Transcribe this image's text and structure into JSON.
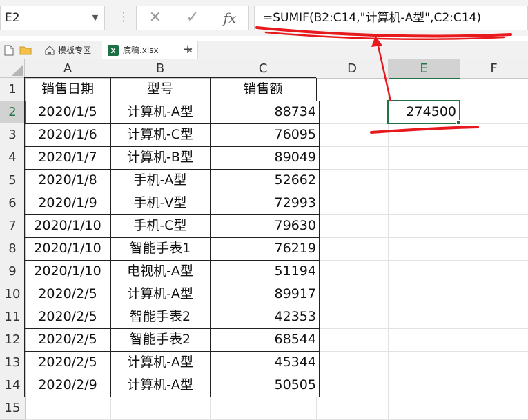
{
  "formula_bar": {
    "name_box": "E2",
    "cancel_icon": "✕",
    "enter_icon": "✓",
    "fx_label": "fx",
    "formula": "=SUMIF(B2:C14,\"计算机-A型\",C2:C14)"
  },
  "tabs": {
    "template_label": "模板专区",
    "file_label": "底稿.xlsx",
    "add_label": "+"
  },
  "sheet": {
    "columns": [
      "A",
      "B",
      "C",
      "D",
      "E",
      "F"
    ],
    "rows": [
      "1",
      "2",
      "3",
      "4",
      "5",
      "6",
      "7",
      "8",
      "9",
      "10",
      "11",
      "12",
      "13",
      "14",
      "15"
    ],
    "headers": {
      "date": "销售日期",
      "model": "型号",
      "amount": "销售额"
    },
    "records": [
      {
        "date": "2020/1/5",
        "model": "计算机-A型",
        "amount": "88734"
      },
      {
        "date": "2020/1/6",
        "model": "计算机-C型",
        "amount": "76095"
      },
      {
        "date": "2020/1/7",
        "model": "计算机-B型",
        "amount": "89049"
      },
      {
        "date": "2020/1/8",
        "model": "手机-A型",
        "amount": "52662"
      },
      {
        "date": "2020/1/9",
        "model": "手机-V型",
        "amount": "72993"
      },
      {
        "date": "2020/1/10",
        "model": "手机-C型",
        "amount": "79630"
      },
      {
        "date": "2020/1/10",
        "model": "智能手表1",
        "amount": "76219"
      },
      {
        "date": "2020/1/10",
        "model": "电视机-A型",
        "amount": "51194"
      },
      {
        "date": "2020/2/5",
        "model": "计算机-A型",
        "amount": "89917"
      },
      {
        "date": "2020/2/5",
        "model": "智能手表2",
        "amount": "42353"
      },
      {
        "date": "2020/2/5",
        "model": "智能手表2",
        "amount": "68544"
      },
      {
        "date": "2020/2/5",
        "model": "计算机-A型",
        "amount": "45344"
      },
      {
        "date": "2020/2/9",
        "model": "计算机-A型",
        "amount": "50505"
      }
    ],
    "result_value": "274500"
  },
  "colors": {
    "selection": "#217346",
    "annotation": "#e8191d",
    "excel_icon": "#1d7044"
  }
}
